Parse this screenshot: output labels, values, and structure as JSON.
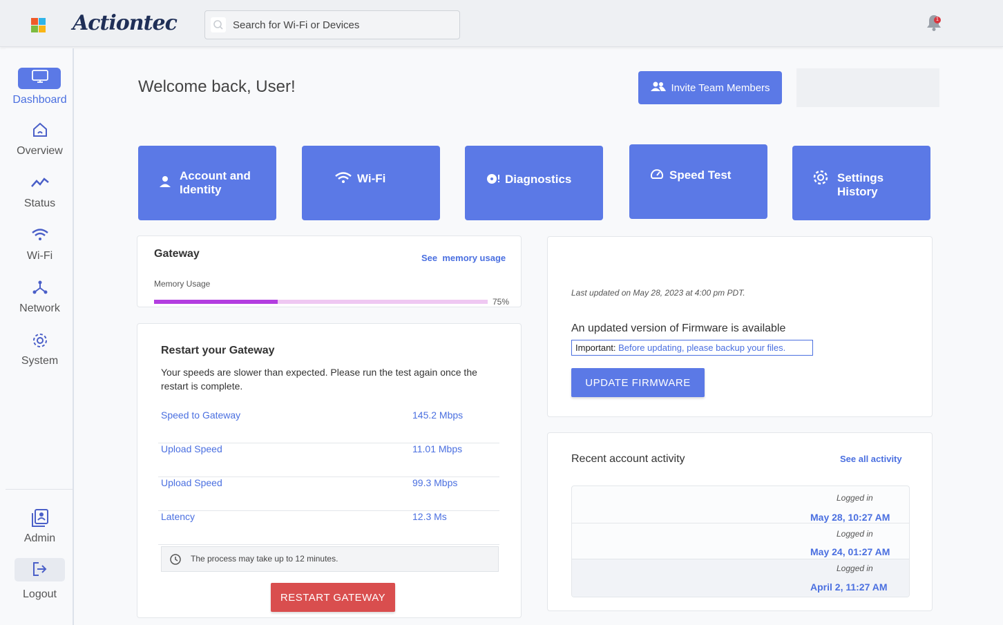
{
  "header": {
    "logo_text": "Actiontec",
    "search_placeholder": "Search for Wi-Fi or Devices",
    "notification_count": "1",
    "app_grid_colors": [
      "#f05a28",
      "#2fb4e8",
      "#7dbb3f",
      "#f9b515"
    ]
  },
  "sidebar": {
    "items": [
      {
        "label": "Dashboard",
        "icon": "monitor-icon",
        "active": true
      },
      {
        "label": "Overview",
        "icon": "home-icon"
      },
      {
        "label": "Status",
        "icon": "activity-icon"
      },
      {
        "label": "Wi-Fi",
        "icon": "wifi-icon"
      },
      {
        "label": "Network",
        "icon": "network-icon"
      },
      {
        "label": "System",
        "icon": "gear-icon"
      }
    ],
    "bottom": [
      {
        "label": "Admin",
        "icon": "admin-icon"
      },
      {
        "label": "Logout",
        "icon": "logout-icon"
      }
    ]
  },
  "main": {
    "welcome": "Welcome back, User!",
    "invite_label": "Invite Team Members",
    "tiles": [
      {
        "label": "Account and Identity",
        "icon": "user-icon"
      },
      {
        "label": "Wi-Fi",
        "icon": "wifi-icon"
      },
      {
        "label": "Diagnostics",
        "icon": "diagnostics-icon"
      },
      {
        "label": "Speed Test",
        "icon": "speedometer-icon"
      },
      {
        "label": "Settings History",
        "icon": "gear-icon"
      }
    ]
  },
  "gateway": {
    "title": "Gateway",
    "link": "See  memory usage",
    "memory_label": "Memory Usage",
    "memory_percent_text": "75%",
    "memory_fill_fraction": 0.37
  },
  "restart": {
    "title": "Restart your Gateway",
    "description": "Your speeds are slower than expected. Please run the test again once the restart is complete.",
    "rows": [
      {
        "label": "Speed to Gateway",
        "value": "145.2 Mbps"
      },
      {
        "label": "Upload Speed",
        "value": "11.01 Mbps"
      },
      {
        "label": "Upload Speed",
        "value": "99.3 Mbps"
      },
      {
        "label": "Latency",
        "value": "12.3 Ms"
      }
    ],
    "note": "The process may take up to 12 minutes.",
    "button": "RESTART GATEWAY"
  },
  "firmware": {
    "updated": "Last updated on May 28, 2023 at 4:00 pm PDT.",
    "title": "An updated version of Firmware is available",
    "important_prefix": "Important: ",
    "important_link": "Before updating, please backup your files.",
    "button": "UPDATE FIRMWARE"
  },
  "activity": {
    "title": "Recent account activity",
    "link": "See all activity",
    "items": [
      {
        "action": "Logged in",
        "date": "May 28, 10:27 AM"
      },
      {
        "action": "Logged in",
        "date": "May 24, 01:27 AM"
      },
      {
        "action": "Logged in",
        "date": "April 2, 11:27 AM"
      }
    ]
  }
}
